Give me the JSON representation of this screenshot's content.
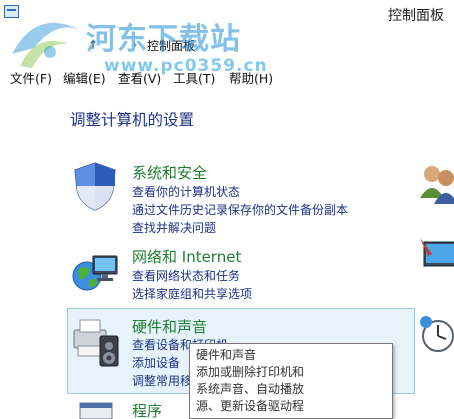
{
  "window": {
    "title": "控制面板"
  },
  "watermark": {
    "site": "河东下载站",
    "url": "www.pc0359.cn"
  },
  "address": {
    "arrow": "↑",
    "sep": "›",
    "location": "控制面板"
  },
  "menu": [
    {
      "label": "文件(F)"
    },
    {
      "label": "编辑(E)"
    },
    {
      "label": "查看(V)"
    },
    {
      "label": "工具(T)"
    },
    {
      "label": "帮助(H)"
    }
  ],
  "page_title": "调整计算机的设置",
  "categories": [
    {
      "title": "系统和安全",
      "icon": "shield-icon",
      "links": [
        "查看你的计算机状态",
        "通过文件历史记录保存你的文件备份副本",
        "查找并解决问题"
      ]
    },
    {
      "title": "网络和 Internet",
      "icon": "network-globe-icon",
      "links": [
        "查看网络状态和任务",
        "选择家庭组和共享选项"
      ]
    },
    {
      "title": "硬件和声音",
      "icon": "printer-speaker-icon",
      "links": [
        "查看设备和打印机",
        "添加设备",
        "调整常用移动设置"
      ]
    },
    {
      "title": "程序",
      "icon": "programs-icon",
      "links": []
    }
  ],
  "tooltip": {
    "lines": [
      "硬件和声音",
      "添加或删除打印机和",
      "系统声音、自动播放",
      "源、更新设备驱动程"
    ]
  },
  "colors": {
    "category_title": "#1e7f32",
    "link": "#1e3287",
    "hover_bg": "#e6f3fb"
  }
}
